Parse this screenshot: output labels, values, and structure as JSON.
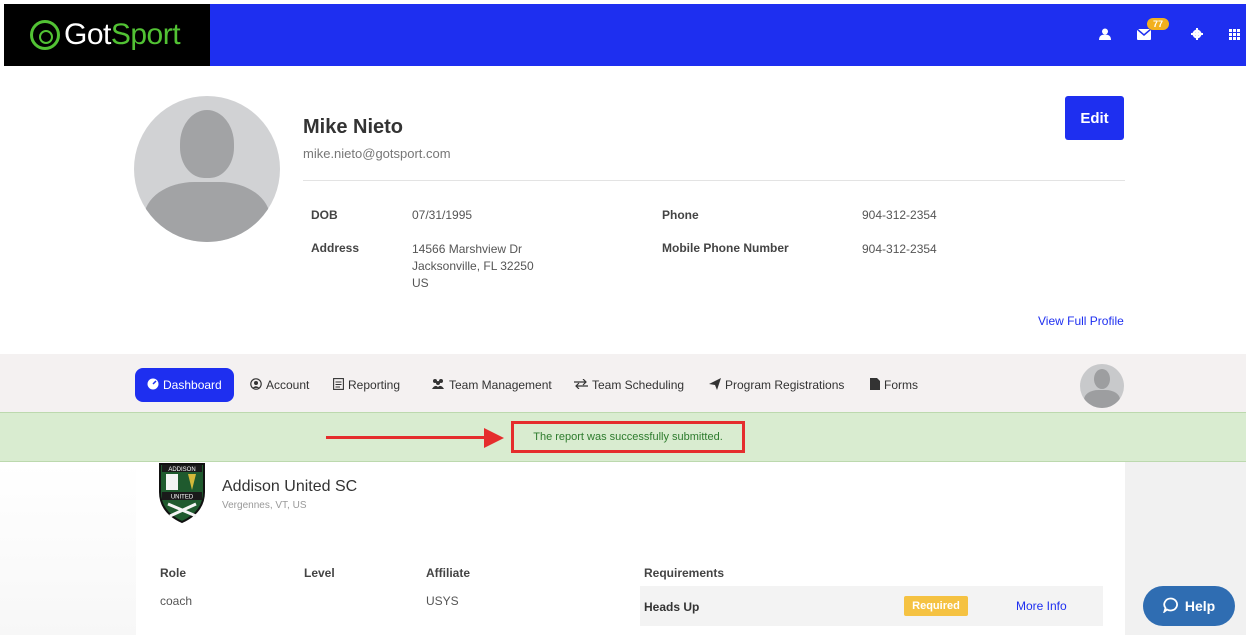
{
  "header": {
    "logo_text_got": "Got",
    "logo_text_sport": "Sport",
    "mail_count": "77",
    "icons": [
      "user-icon",
      "mail-icon",
      "gear-icon",
      "apps-grid-icon"
    ]
  },
  "profile": {
    "name": "Mike Nieto",
    "email": "mike.nieto@gotsport.com",
    "dob_label": "DOB",
    "dob": "07/31/1995",
    "address_label": "Address",
    "address_line1": "14566 Marshview Dr",
    "address_line2": "Jacksonville, FL 32250",
    "address_line3": "US",
    "phone_label": "Phone",
    "phone": "904-312-2354",
    "mobile_label": "Mobile Phone Number",
    "mobile": "904-312-2354",
    "edit_label": "Edit",
    "full_profile_label": "View Full Profile"
  },
  "nav": {
    "items": [
      {
        "label": "Dashboard",
        "icon": "dashboard-icon"
      },
      {
        "label": "Account",
        "icon": "account-icon"
      },
      {
        "label": "Reporting",
        "icon": "reporting-icon"
      },
      {
        "label": "Team Management",
        "icon": "team-management-icon"
      },
      {
        "label": "Team Scheduling",
        "icon": "team-scheduling-icon"
      },
      {
        "label": "Program Registrations",
        "icon": "program-registrations-icon"
      },
      {
        "label": "Forms",
        "icon": "forms-icon"
      }
    ],
    "active": "Dashboard"
  },
  "alert": {
    "message": "The report was successfully submitted."
  },
  "club": {
    "name": "Addison United SC",
    "location": "Vergennes, VT, US",
    "crest_top_text": "ADDISON",
    "crest_mid_text": "UNITED",
    "columns": [
      "Role",
      "Level",
      "Affiliate"
    ],
    "row": [
      "coach",
      "",
      "USYS"
    ]
  },
  "requirements": {
    "header": "Requirements",
    "items": [
      {
        "title": "Heads Up",
        "status": "Required",
        "link": "More Info"
      }
    ]
  },
  "help": {
    "label": "Help"
  },
  "colors": {
    "brand_blue": "#1e2ff0",
    "brand_green": "#52c234",
    "success_bg": "#d9ecd0",
    "annotation_red": "#e52d2d",
    "required_yellow": "#f5c242"
  }
}
